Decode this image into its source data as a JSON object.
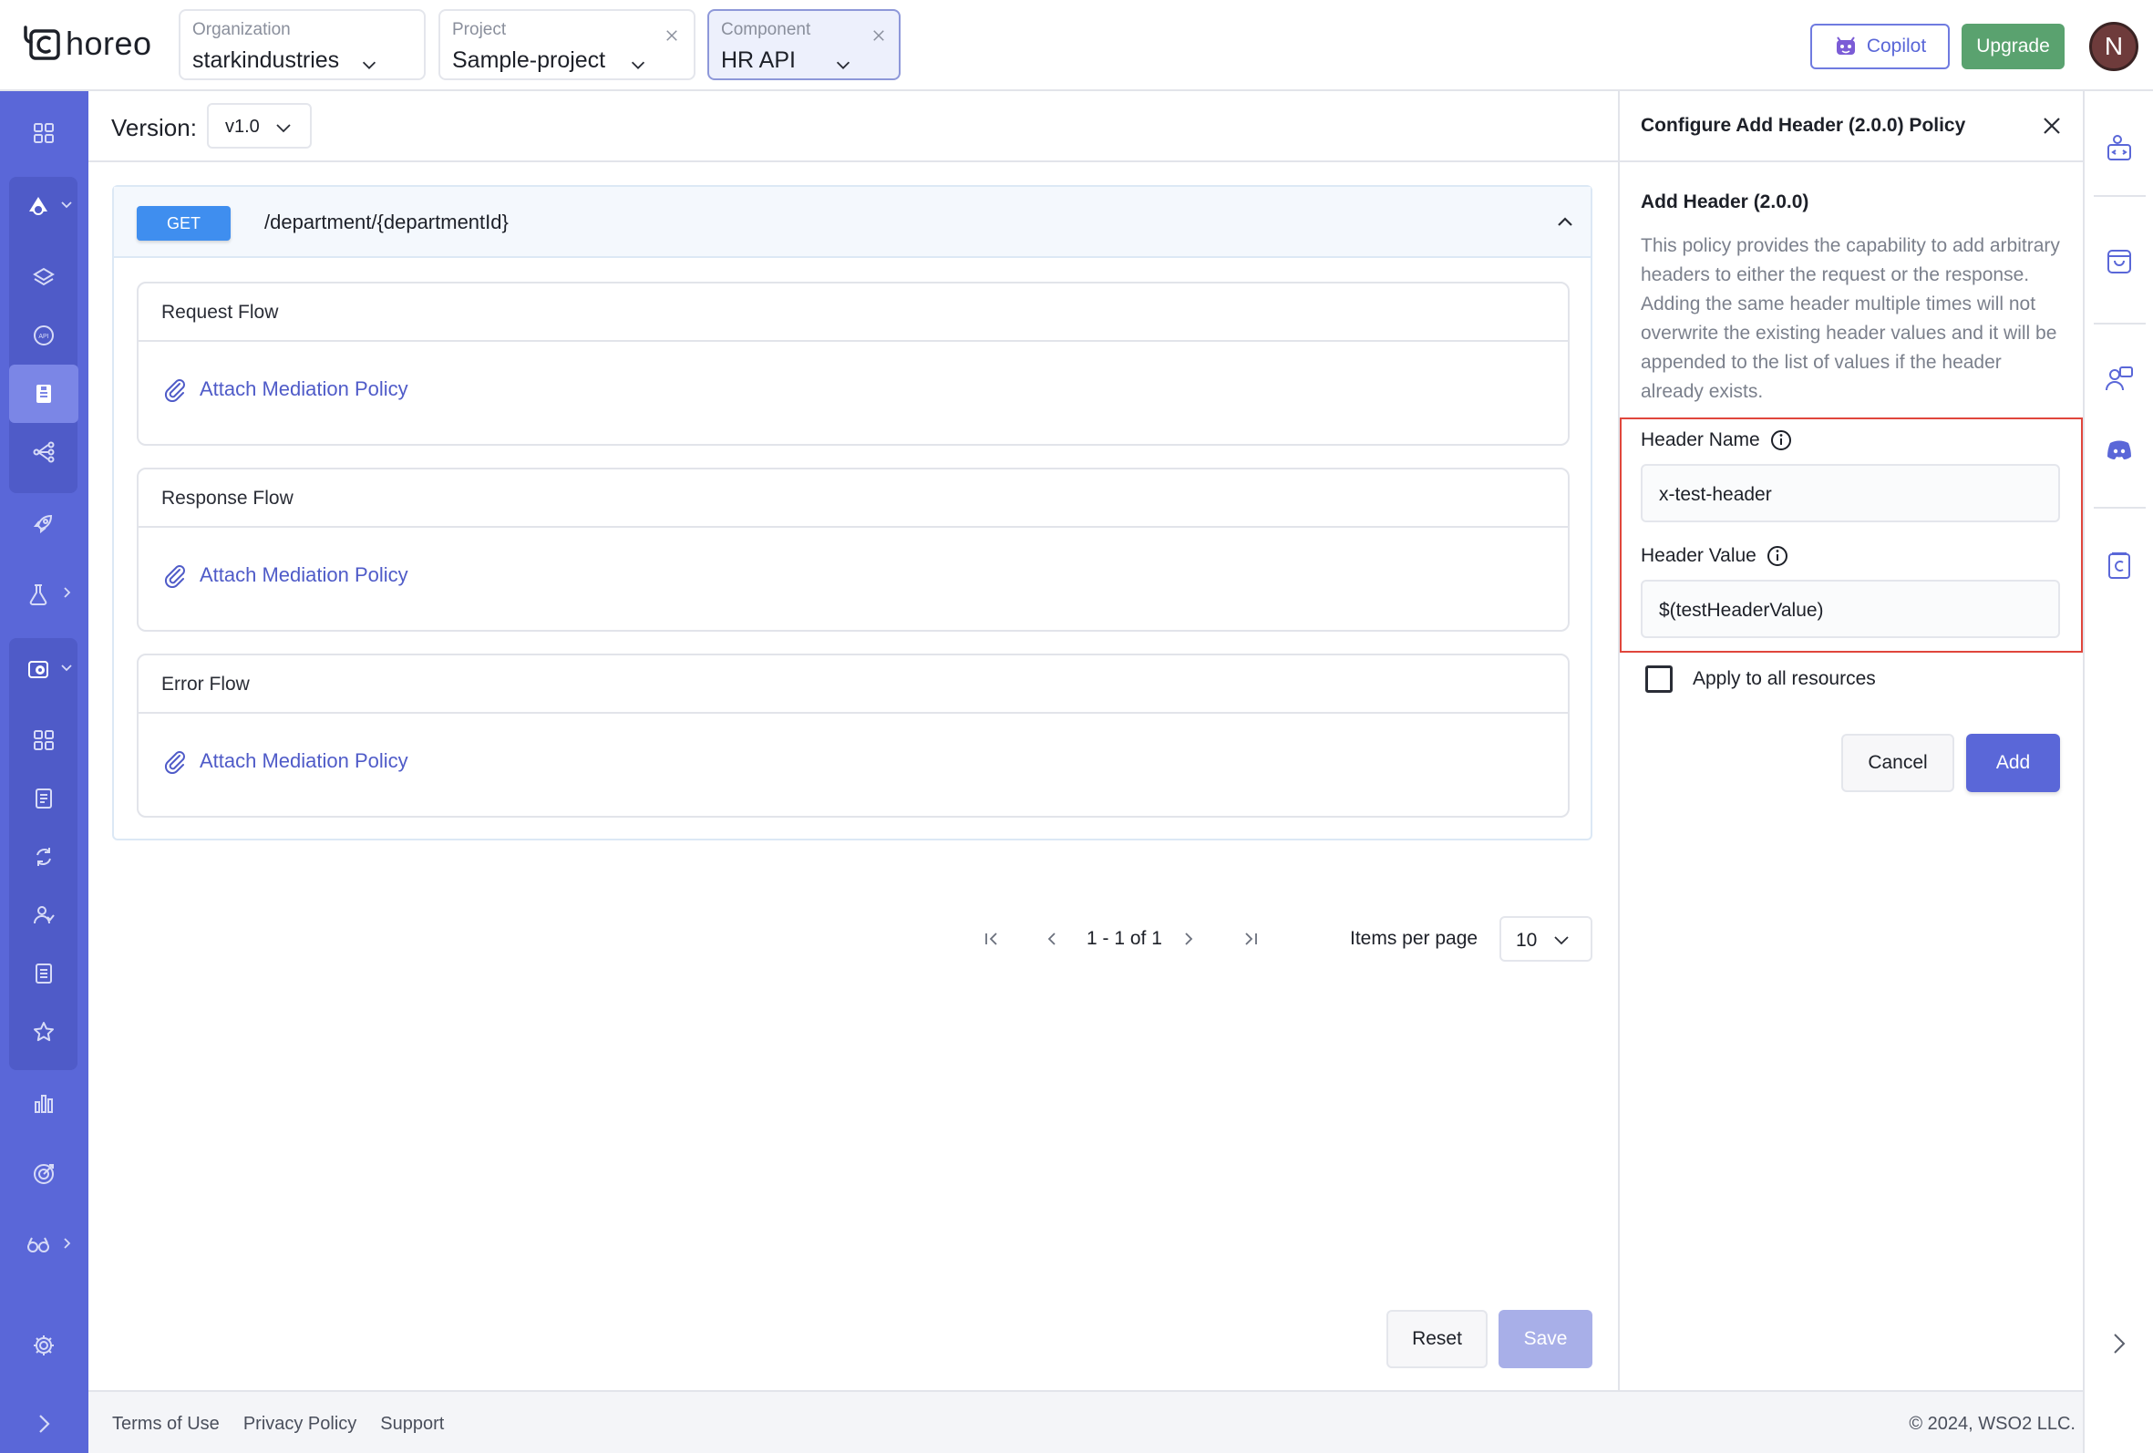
{
  "brand": {
    "name": "horeo"
  },
  "header": {
    "organization": {
      "label": "Organization",
      "value": "starkindustries"
    },
    "project": {
      "label": "Project",
      "value": "Sample-project"
    },
    "component": {
      "label": "Component",
      "value": "HR API"
    },
    "copilot_label": "Copilot",
    "upgrade_label": "Upgrade",
    "avatar_initial": "N"
  },
  "colors": {
    "nav_bg": "#5a67d8",
    "accent": "#5a67d8",
    "upgrade": "#5aa26f",
    "method_get": "#3f8eef",
    "highlight_border": "#e0463c"
  },
  "left_nav": {
    "icons": [
      "dashboard-icon",
      "deploy-icon",
      "layers-icon",
      "api-icon",
      "document-icon",
      "workflow-icon",
      "rocket-icon",
      "test-icon",
      "settings-cog-icon",
      "overview-icon",
      "logs-icon",
      "sync-icon",
      "users-icon",
      "list-icon",
      "star-icon",
      "bar-chart-icon",
      "target-icon",
      "glasses-icon",
      "gear-icon",
      "expand-icon"
    ]
  },
  "main": {
    "version_label": "Version:",
    "version_value": "v1.0",
    "resource": {
      "method": "GET",
      "path": "/department/{departmentId}"
    },
    "flows": [
      {
        "title": "Request Flow",
        "action": "Attach Mediation Policy"
      },
      {
        "title": "Response Flow",
        "action": "Attach Mediation Policy"
      },
      {
        "title": "Error Flow",
        "action": "Attach Mediation Policy"
      }
    ],
    "pagination": {
      "range": "1 - 1 of 1",
      "items_per_page_label": "Items per page",
      "items_per_page": "10"
    },
    "reset_label": "Reset",
    "save_label": "Save"
  },
  "panel": {
    "title": "Configure Add Header (2.0.0) Policy",
    "policy_name": "Add Header (2.0.0)",
    "description": "This policy provides the capability to add arbitrary headers to either the request or the response. Adding the same header multiple times will not overwrite the existing header values and it will be appended to the list of values if the header already exists.",
    "header_name_label": "Header Name",
    "header_name_value": "x-test-header",
    "header_value_label": "Header Value",
    "header_value_value": "$(testHeaderValue)",
    "apply_all_label": "Apply to all resources",
    "apply_all_checked": false,
    "cancel_label": "Cancel",
    "add_label": "Add"
  },
  "footer": {
    "terms": "Terms of Use",
    "privacy": "Privacy Policy",
    "support": "Support",
    "copyright": "© 2024, WSO2 LLC."
  }
}
